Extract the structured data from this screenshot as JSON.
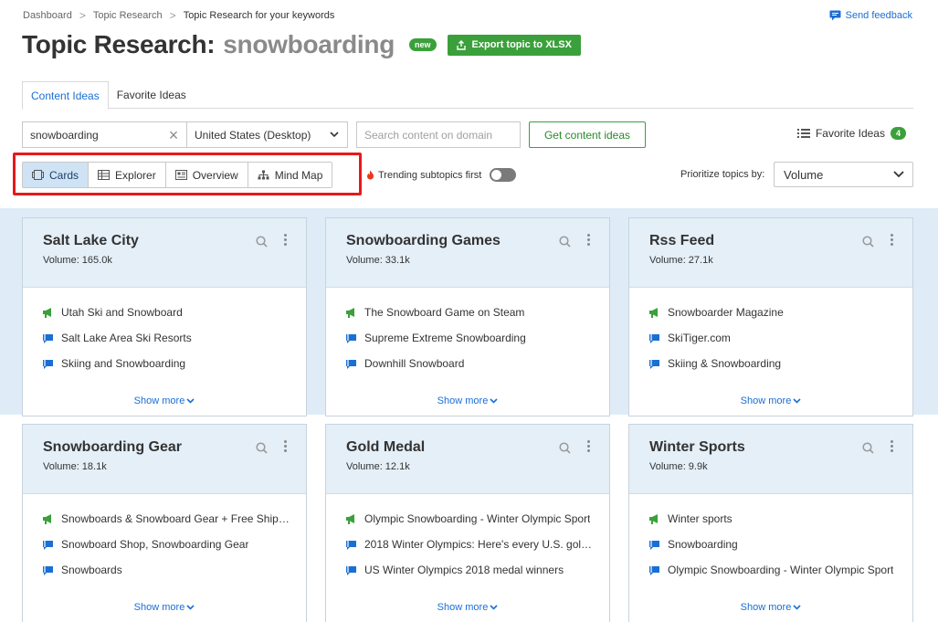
{
  "breadcrumb": {
    "items": [
      "Dashboard",
      "Topic Research",
      "Topic Research for your keywords"
    ],
    "separator": ">"
  },
  "feedback": {
    "label": "Send feedback"
  },
  "header": {
    "title": "Topic Research:",
    "keyword": "snowboarding",
    "badge": "new",
    "export_label": "Export topic to XLSX"
  },
  "tabs": [
    {
      "label": "Content Ideas",
      "active": true
    },
    {
      "label": "Favorite Ideas",
      "active": false
    }
  ],
  "controls": {
    "keyword_value": "snowboarding",
    "database_value": "United States (Desktop)",
    "domain_placeholder": "Search content on domain",
    "get_ideas_label": "Get content ideas",
    "favorite_label": "Favorite Ideas",
    "favorite_count": "4"
  },
  "views": {
    "buttons": [
      {
        "label": "Cards",
        "active": true,
        "icon": "cards-icon"
      },
      {
        "label": "Explorer",
        "active": false,
        "icon": "table-icon"
      },
      {
        "label": "Overview",
        "active": false,
        "icon": "overview-icon"
      },
      {
        "label": "Mind Map",
        "active": false,
        "icon": "mindmap-icon"
      }
    ],
    "trending_label": "Trending subtopics first",
    "trending_on": false,
    "prioritize_label": "Prioritize topics by:",
    "prioritize_value": "Volume"
  },
  "colors": {
    "accent_blue": "#1a6fd4",
    "green": "#3ba03b",
    "highlight_red": "#e8191a",
    "band_blue": "#dfecf7"
  },
  "cards": [
    {
      "title": "Salt Lake City",
      "volume": "Volume: 165.0k",
      "items": [
        {
          "text": "Utah Ski and Snowboard",
          "icon": "green"
        },
        {
          "text": "Salt Lake Area Ski Resorts",
          "icon": "blue"
        },
        {
          "text": "Skiing and Snowboarding",
          "icon": "blue"
        }
      ],
      "show_more": "Show more"
    },
    {
      "title": "Snowboarding Games",
      "volume": "Volume: 33.1k",
      "items": [
        {
          "text": "The Snowboard Game on Steam",
          "icon": "green"
        },
        {
          "text": "Supreme Extreme Snowboarding",
          "icon": "blue"
        },
        {
          "text": "Downhill Snowboard",
          "icon": "blue"
        }
      ],
      "show_more": "Show more"
    },
    {
      "title": "Rss Feed",
      "volume": "Volume: 27.1k",
      "items": [
        {
          "text": "Snowboarder Magazine",
          "icon": "green"
        },
        {
          "text": "SkiTiger.com",
          "icon": "blue"
        },
        {
          "text": "Skiing & Snowboarding",
          "icon": "blue"
        }
      ],
      "show_more": "Show more"
    },
    {
      "title": "Snowboarding Gear",
      "volume": "Volume: 18.1k",
      "items": [
        {
          "text": "Snowboards & Snowboard Gear + Free Shipp…",
          "icon": "green"
        },
        {
          "text": "Snowboard Shop, Snowboarding Gear",
          "icon": "blue"
        },
        {
          "text": "Snowboards",
          "icon": "blue"
        }
      ],
      "show_more": "Show more"
    },
    {
      "title": "Gold Medal",
      "volume": "Volume: 12.1k",
      "items": [
        {
          "text": "Olympic Snowboarding - Winter Olympic Sport",
          "icon": "green"
        },
        {
          "text": "2018 Winter Olympics: Here's every U.S. gol…",
          "icon": "blue"
        },
        {
          "text": "US Winter Olympics 2018 medal winners",
          "icon": "blue"
        }
      ],
      "show_more": "Show more"
    },
    {
      "title": "Winter Sports",
      "volume": "Volume: 9.9k",
      "items": [
        {
          "text": "Winter sports",
          "icon": "green"
        },
        {
          "text": "Snowboarding",
          "icon": "blue"
        },
        {
          "text": "Olympic Snowboarding - Winter Olympic Sport",
          "icon": "blue"
        }
      ],
      "show_more": "Show more"
    }
  ]
}
